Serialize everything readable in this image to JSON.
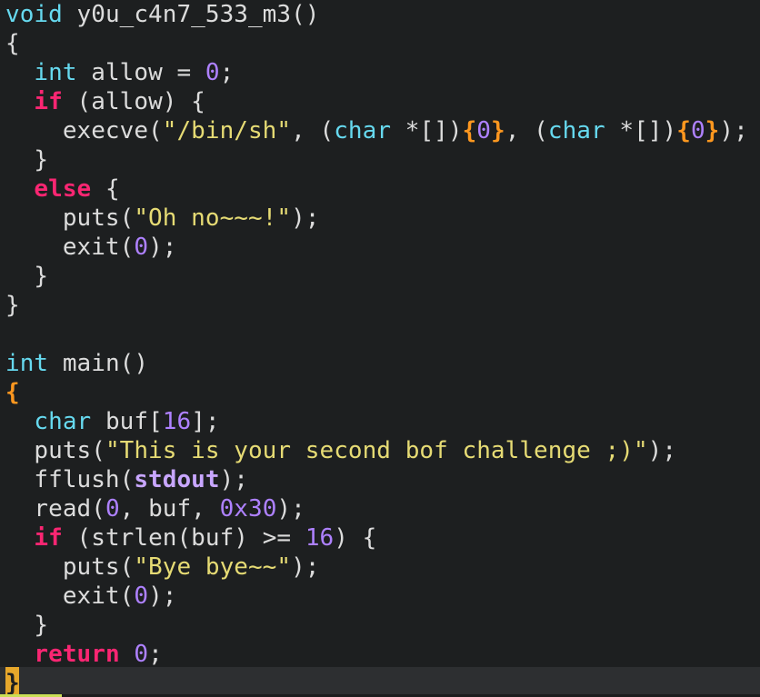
{
  "colors": {
    "background": "#1d1f20",
    "cursorline": "#2d2f31",
    "cursor": "#e6a72b",
    "plain": "#dcdcdc",
    "type": "#66d9ef",
    "control": "#f92672",
    "number": "#ae81ff",
    "string": "#e6db74",
    "highlight_brace": "#fd971f",
    "builtin": "#c8a6ff"
  },
  "code": {
    "lines": [
      [
        {
          "t": "void",
          "k": "type"
        },
        {
          "t": " y0u_c4n7_533_m3()",
          "k": "plain"
        }
      ],
      [
        {
          "t": "{",
          "k": "plain"
        }
      ],
      [
        {
          "t": "  ",
          "k": "plain"
        },
        {
          "t": "int",
          "k": "type"
        },
        {
          "t": " allow = ",
          "k": "plain"
        },
        {
          "t": "0",
          "k": "number"
        },
        {
          "t": ";",
          "k": "plain"
        }
      ],
      [
        {
          "t": "  ",
          "k": "plain"
        },
        {
          "t": "if",
          "k": "control"
        },
        {
          "t": " (allow) {",
          "k": "plain"
        }
      ],
      [
        {
          "t": "    execve(",
          "k": "plain"
        },
        {
          "t": "\"/bin/sh\"",
          "k": "string"
        },
        {
          "t": ", (",
          "k": "plain"
        },
        {
          "t": "char",
          "k": "type"
        },
        {
          "t": " *[])",
          "k": "plain"
        },
        {
          "t": "{",
          "k": "highlight_brace"
        },
        {
          "t": "0",
          "k": "number"
        },
        {
          "t": "}",
          "k": "highlight_brace"
        },
        {
          "t": ", (",
          "k": "plain"
        },
        {
          "t": "char",
          "k": "type"
        },
        {
          "t": " *[])",
          "k": "plain"
        },
        {
          "t": "{",
          "k": "highlight_brace"
        },
        {
          "t": "0",
          "k": "number"
        },
        {
          "t": "}",
          "k": "highlight_brace"
        },
        {
          "t": ");",
          "k": "plain"
        }
      ],
      [
        {
          "t": "  }",
          "k": "plain"
        }
      ],
      [
        {
          "t": "  ",
          "k": "plain"
        },
        {
          "t": "else",
          "k": "control"
        },
        {
          "t": " {",
          "k": "plain"
        }
      ],
      [
        {
          "t": "    puts(",
          "k": "plain"
        },
        {
          "t": "\"Oh no~~~!\"",
          "k": "string"
        },
        {
          "t": ");",
          "k": "plain"
        }
      ],
      [
        {
          "t": "    exit(",
          "k": "plain"
        },
        {
          "t": "0",
          "k": "number"
        },
        {
          "t": ");",
          "k": "plain"
        }
      ],
      [
        {
          "t": "  }",
          "k": "plain"
        }
      ],
      [
        {
          "t": "}",
          "k": "plain"
        }
      ],
      [],
      [
        {
          "t": "int",
          "k": "type"
        },
        {
          "t": " main()",
          "k": "plain"
        }
      ],
      [
        {
          "t": "{",
          "k": "highlight_brace"
        }
      ],
      [
        {
          "t": "  ",
          "k": "plain"
        },
        {
          "t": "char",
          "k": "type"
        },
        {
          "t": " buf[",
          "k": "plain"
        },
        {
          "t": "16",
          "k": "number"
        },
        {
          "t": "];",
          "k": "plain"
        }
      ],
      [
        {
          "t": "  puts(",
          "k": "plain"
        },
        {
          "t": "\"This is your second bof challenge ;)\"",
          "k": "string"
        },
        {
          "t": ");",
          "k": "plain"
        }
      ],
      [
        {
          "t": "  fflush(",
          "k": "plain"
        },
        {
          "t": "stdout",
          "k": "builtin"
        },
        {
          "t": ");",
          "k": "plain"
        }
      ],
      [
        {
          "t": "  read(",
          "k": "plain"
        },
        {
          "t": "0",
          "k": "number"
        },
        {
          "t": ", buf, ",
          "k": "plain"
        },
        {
          "t": "0x30",
          "k": "number"
        },
        {
          "t": ");",
          "k": "plain"
        }
      ],
      [
        {
          "t": "  ",
          "k": "plain"
        },
        {
          "t": "if",
          "k": "control"
        },
        {
          "t": " (strlen(buf) >= ",
          "k": "plain"
        },
        {
          "t": "16",
          "k": "number"
        },
        {
          "t": ") {",
          "k": "plain"
        }
      ],
      [
        {
          "t": "    puts(",
          "k": "plain"
        },
        {
          "t": "\"Bye bye~~\"",
          "k": "string"
        },
        {
          "t": ");",
          "k": "plain"
        }
      ],
      [
        {
          "t": "    exit(",
          "k": "plain"
        },
        {
          "t": "0",
          "k": "number"
        },
        {
          "t": ");",
          "k": "plain"
        }
      ],
      [
        {
          "t": "  }",
          "k": "plain"
        }
      ],
      [
        {
          "t": "  ",
          "k": "plain"
        },
        {
          "t": "return",
          "k": "control"
        },
        {
          "t": " ",
          "k": "plain"
        },
        {
          "t": "0",
          "k": "number"
        },
        {
          "t": ";",
          "k": "plain"
        }
      ],
      [
        {
          "t": "}",
          "k": "cursor_char"
        }
      ]
    ]
  }
}
